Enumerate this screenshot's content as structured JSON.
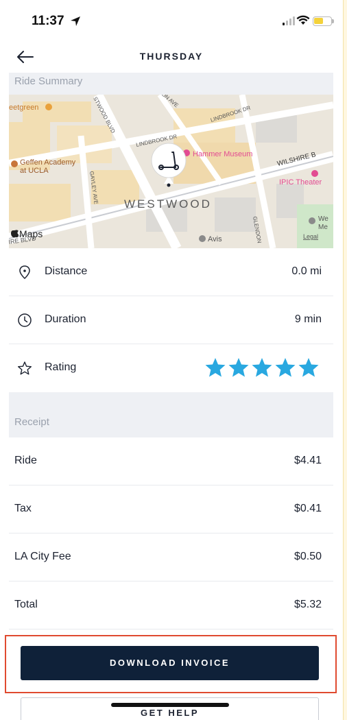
{
  "status_bar": {
    "time": "11:37"
  },
  "header": {
    "title": "THURSDAY"
  },
  "ride_summary": {
    "heading": "Ride Summary",
    "map": {
      "labels": {
        "westwood": "WESTWOOD",
        "geffen": "Geffen Academy",
        "geffen2": "at UCLA",
        "hammer": "Hammer Museum",
        "ipic": "IPIC Theater",
        "wilshire": "WILSHIRE B",
        "lindbrook1": "LINDBROOK DR",
        "lindbrook2": "LINDBROOK DR",
        "lindbrook3": "LINDBROOK DR",
        "gayley": "GAYLEY AVE",
        "westwood_blvd": "STWOOD BLVD",
        "glendon": "GLENDON",
        "avis": "Avis",
        "legal": "Legal",
        "maps": "Maps",
        "wilshire_low": "IRE BLVD",
        "eetgreen": "eetgreen",
        "on_ave": "ON AVE",
        "we": "We",
        "me": "Me"
      }
    },
    "rows": [
      {
        "label": "Distance",
        "value": "0.0 mi",
        "icon": "location-pin-icon"
      },
      {
        "label": "Duration",
        "value": "9 min",
        "icon": "clock-icon"
      },
      {
        "label": "Rating",
        "rating": 5,
        "max": 5,
        "icon": "star-outline-icon"
      }
    ]
  },
  "receipt": {
    "heading": "Receipt",
    "items": [
      {
        "label": "Ride",
        "value": "$4.41"
      },
      {
        "label": "Tax",
        "value": "$0.41"
      },
      {
        "label": "LA City Fee",
        "value": "$0.50"
      },
      {
        "label": "Total",
        "value": "$5.32"
      }
    ]
  },
  "actions": {
    "download_invoice": "DOWNLOAD INVOICE",
    "get_help": "GET HELP"
  },
  "colors": {
    "accent_star": "#29a8e0",
    "button_dark": "#0f2139",
    "highlight": "#e04a2f"
  }
}
